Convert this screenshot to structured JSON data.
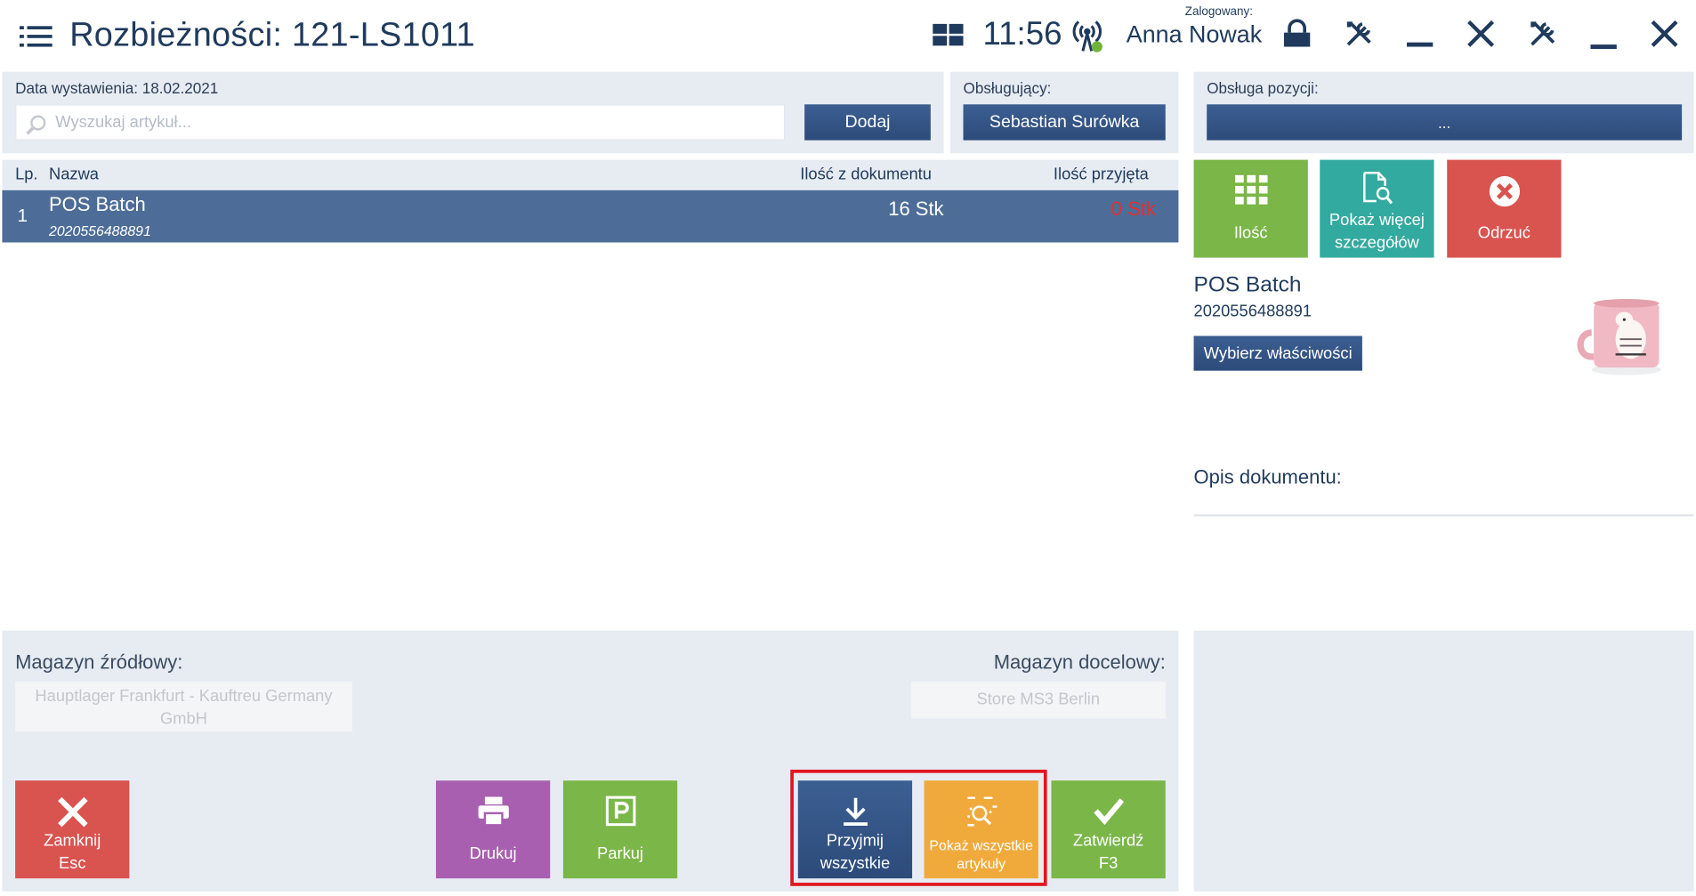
{
  "header": {
    "title": "Rozbieżności: 121-LS1011",
    "time": "11:56",
    "user_label": "Zalogowany:",
    "user_name": "Anna Nowak"
  },
  "document": {
    "issue_date_label": "Data wystawienia: 18.02.2021",
    "search_placeholder": "Wyszukaj artykuł...",
    "add_button": "Dodaj",
    "cashier_label": "Obsługujący:",
    "cashier_name": "Sebastian Surówka",
    "position_handling_label": "Obsługa pozycji:",
    "position_handling_value": "..."
  },
  "table": {
    "headers": {
      "lp": "Lp.",
      "name": "Nazwa",
      "qty_doc": "Ilość z dokumentu",
      "qty_recv": "Ilość przyjęta"
    },
    "rows": [
      {
        "lp": "1",
        "name": "POS Batch",
        "code": "2020556488891",
        "qty_doc": "16 Stk",
        "qty_recv": "0 Stk"
      }
    ]
  },
  "side_tiles": {
    "qty": "Ilość",
    "details": "Pokaż więcej szczegółów",
    "reject": "Odrzuć"
  },
  "item": {
    "name": "POS Batch",
    "code": "2020556488891",
    "choose_props": "Wybierz właściwości",
    "doc_desc_label": "Opis dokumentu:"
  },
  "warehouses": {
    "source_label": "Magazyn źródłowy:",
    "source_value": "Hauptlager Frankfurt -  Kauftreu Germany GmbH",
    "target_label": "Magazyn docelowy:",
    "target_value": "Store MS3 Berlin"
  },
  "actions": {
    "close": "Zamknij",
    "close_key": "Esc",
    "print": "Drukuj",
    "park": "Parkuj",
    "accept_all": "Przyjmij wszystkie",
    "show_all": "Pokaż wszystkie artykuły",
    "confirm": "Zatwierdź",
    "confirm_key": "F3"
  },
  "colors": {
    "accent": "#2c4b7a",
    "selected_row": "#4d6d98",
    "green": "#7ab648",
    "teal": "#33aaa0",
    "red": "#d9534f",
    "purple": "#a95fb0",
    "orange": "#f0aa3c",
    "highlight": "#e0141e",
    "qty_zero": "#e03030"
  }
}
